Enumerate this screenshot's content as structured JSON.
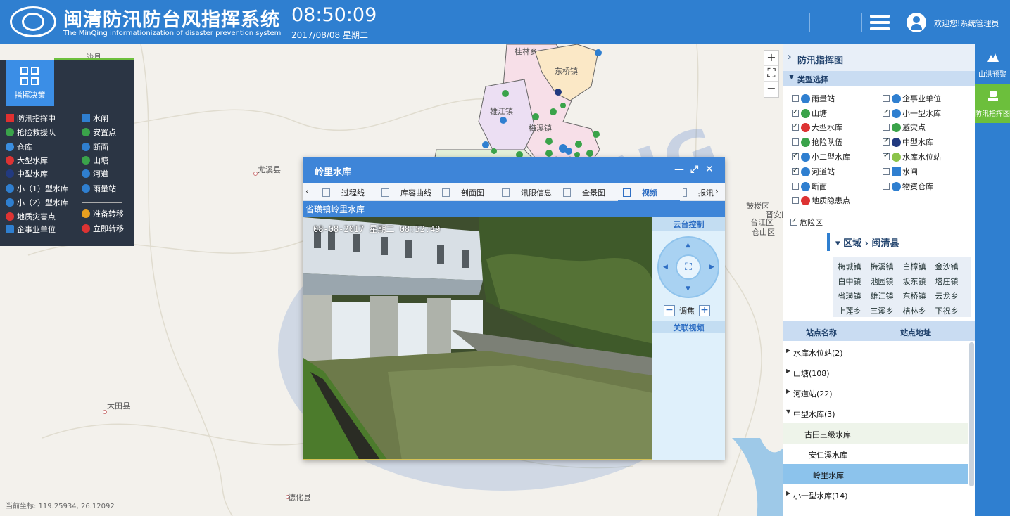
{
  "header": {
    "title": "闽清防汛防台风指挥系统",
    "subtitle": "The MinQing informationization of disaster prevention system",
    "time": "08:50:09",
    "date": "2017/08/08 星期二",
    "welcome": "欢迎您!系统管理员"
  },
  "map": {
    "places": [
      "沙县",
      "尤溪县",
      "大田县",
      "德化县",
      "桂林乡",
      "东桥镇",
      "雄江镇",
      "梅溪镇",
      "鼓楼区",
      "台江区",
      "仓山区",
      "晋安区"
    ],
    "coordinate": "当前坐标: 119.25934, 26.12092",
    "watermark": "STRONG"
  },
  "legend": {
    "tab_label": "指挥决策",
    "items": [
      {
        "label": "防汛指挥中",
        "icon": "red-flag-icon",
        "color": "#e03030"
      },
      {
        "label": "水闸",
        "icon": "sluice-icon",
        "color": "#2f7fd0"
      },
      {
        "label": "抢险救援队",
        "icon": "rescue-team-icon",
        "color": "#3aa34a"
      },
      {
        "label": "安置点",
        "icon": "shelter-icon",
        "color": "#3aa34a"
      },
      {
        "label": "仓库",
        "icon": "warehouse-icon",
        "color": "#3a8ee0"
      },
      {
        "label": "断面",
        "icon": "section-icon",
        "color": "#2f7fd0"
      },
      {
        "label": "大型水库",
        "icon": "large-reservoir-icon",
        "color": "#d33"
      },
      {
        "label": "山塘",
        "icon": "pond-icon",
        "color": "#3aa34a"
      },
      {
        "label": "中型水库",
        "icon": "medium-reservoir-icon",
        "color": "#223a80"
      },
      {
        "label": "河道",
        "icon": "river-icon",
        "color": "#2f7fd0"
      },
      {
        "label": "小（1）型水库",
        "icon": "small1-reservoir-icon",
        "color": "#2f7fd0"
      },
      {
        "label": "雨量站",
        "icon": "rain-station-icon",
        "color": "#2f7fd0"
      },
      {
        "label": "小（2）型水库",
        "icon": "small2-reservoir-icon",
        "color": "#2f7fd0"
      },
      {
        "label": "地质灾害点",
        "icon": "geo-hazard-icon",
        "color": "#d33"
      },
      {
        "label": "准备转移",
        "icon": "prepare-transfer-icon",
        "color": "#e8a020"
      },
      {
        "label": "企事业单位",
        "icon": "enterprise-icon",
        "color": "#2f7fd0"
      },
      {
        "label": "立即转移",
        "icon": "immediate-transfer-icon",
        "color": "#d33"
      }
    ]
  },
  "right_panel": {
    "title": "防汛指挥图",
    "type_section": "类型选择",
    "checkboxes": [
      {
        "label": "雨量站",
        "checked": false,
        "color": "#2f7fd0"
      },
      {
        "label": "企事业单位",
        "checked": false,
        "color": "#2f7fd0"
      },
      {
        "label": "山塘",
        "checked": true,
        "color": "#3aa34a"
      },
      {
        "label": "小一型水库",
        "checked": true,
        "color": "#2f7fd0"
      },
      {
        "label": "大型水库",
        "checked": true,
        "color": "#d33"
      },
      {
        "label": "避灾点",
        "checked": false,
        "color": "#3aa34a"
      },
      {
        "label": "抢险队伍",
        "checked": false,
        "color": "#3aa34a"
      },
      {
        "label": "中型水库",
        "checked": true,
        "color": "#223a80"
      },
      {
        "label": "小二型水库",
        "checked": true,
        "color": "#2f7fd0"
      },
      {
        "label": "水库水位站",
        "checked": true,
        "color": "#8bc34a"
      },
      {
        "label": "河道站",
        "checked": true,
        "color": "#2f7fd0"
      },
      {
        "label": "水闸",
        "checked": false,
        "color": "#2f7fd0"
      },
      {
        "label": "断面",
        "checked": false,
        "color": "#2f7fd0"
      },
      {
        "label": "物资仓库",
        "checked": false,
        "color": "#2f7fd0"
      },
      {
        "label": "地质隐患点",
        "checked": false,
        "color": "#d33"
      }
    ],
    "danger_zone": {
      "label": "危险区",
      "checked": true
    },
    "region": {
      "label": "区域",
      "county": "闽清县"
    },
    "towns": [
      "梅城镇",
      "梅溪镇",
      "白樟镇",
      "金沙镇",
      "白中镇",
      "池园镇",
      "坂东镇",
      "塔庄镇",
      "省璜镇",
      "雄江镇",
      "东桥镇",
      "云龙乡",
      "上莲乡",
      "三溪乡",
      "桔林乡",
      "下祝乡"
    ],
    "station_header": {
      "name": "站点名称",
      "address": "站点地址"
    },
    "tree": [
      {
        "label": "水库水位站(2)"
      },
      {
        "label": "山塘(108)"
      },
      {
        "label": "河道站(22)"
      },
      {
        "label": "中型水库(3)"
      },
      {
        "label": "古田三级水库"
      },
      {
        "label": "安仁溪水库"
      },
      {
        "label": "岭里水库"
      },
      {
        "label": "小一型水库(14)"
      }
    ]
  },
  "side_strip": {
    "buttons": [
      "山洪预警",
      "防汛指挥图"
    ]
  },
  "dialog": {
    "title": "岭里水库",
    "tabs": [
      "过程线",
      "库容曲线",
      "剖面图",
      "汛限信息",
      "全景图",
      "视频",
      "报汛"
    ],
    "active_tab": "视频",
    "location": "省璜镇岭里水库",
    "osd": "08-08-2017 星期二 08:52:49",
    "ptz_title": "云台控制",
    "focus_label": "调焦",
    "related_video": "关联视频"
  }
}
